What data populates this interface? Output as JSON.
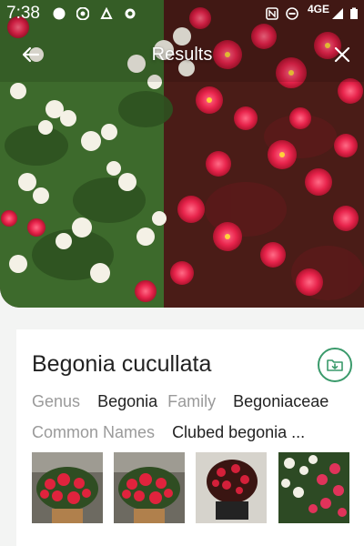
{
  "status_bar": {
    "time": "7:38",
    "network": "4GE"
  },
  "header": {
    "title": "Results"
  },
  "plant": {
    "scientific_name": "Begonia cucullata",
    "genus_label": "Genus",
    "genus_value": "Begonia",
    "family_label": "Family",
    "family_value": "Begoniaceae",
    "common_names_label": "Common Names",
    "common_names_value": "Clubed begonia ..."
  },
  "icons": {
    "back": "arrow-left",
    "close": "x",
    "save": "folder-download"
  },
  "colors": {
    "accent": "#3a9a6b",
    "label": "#9a9a9a",
    "text": "#222222"
  }
}
